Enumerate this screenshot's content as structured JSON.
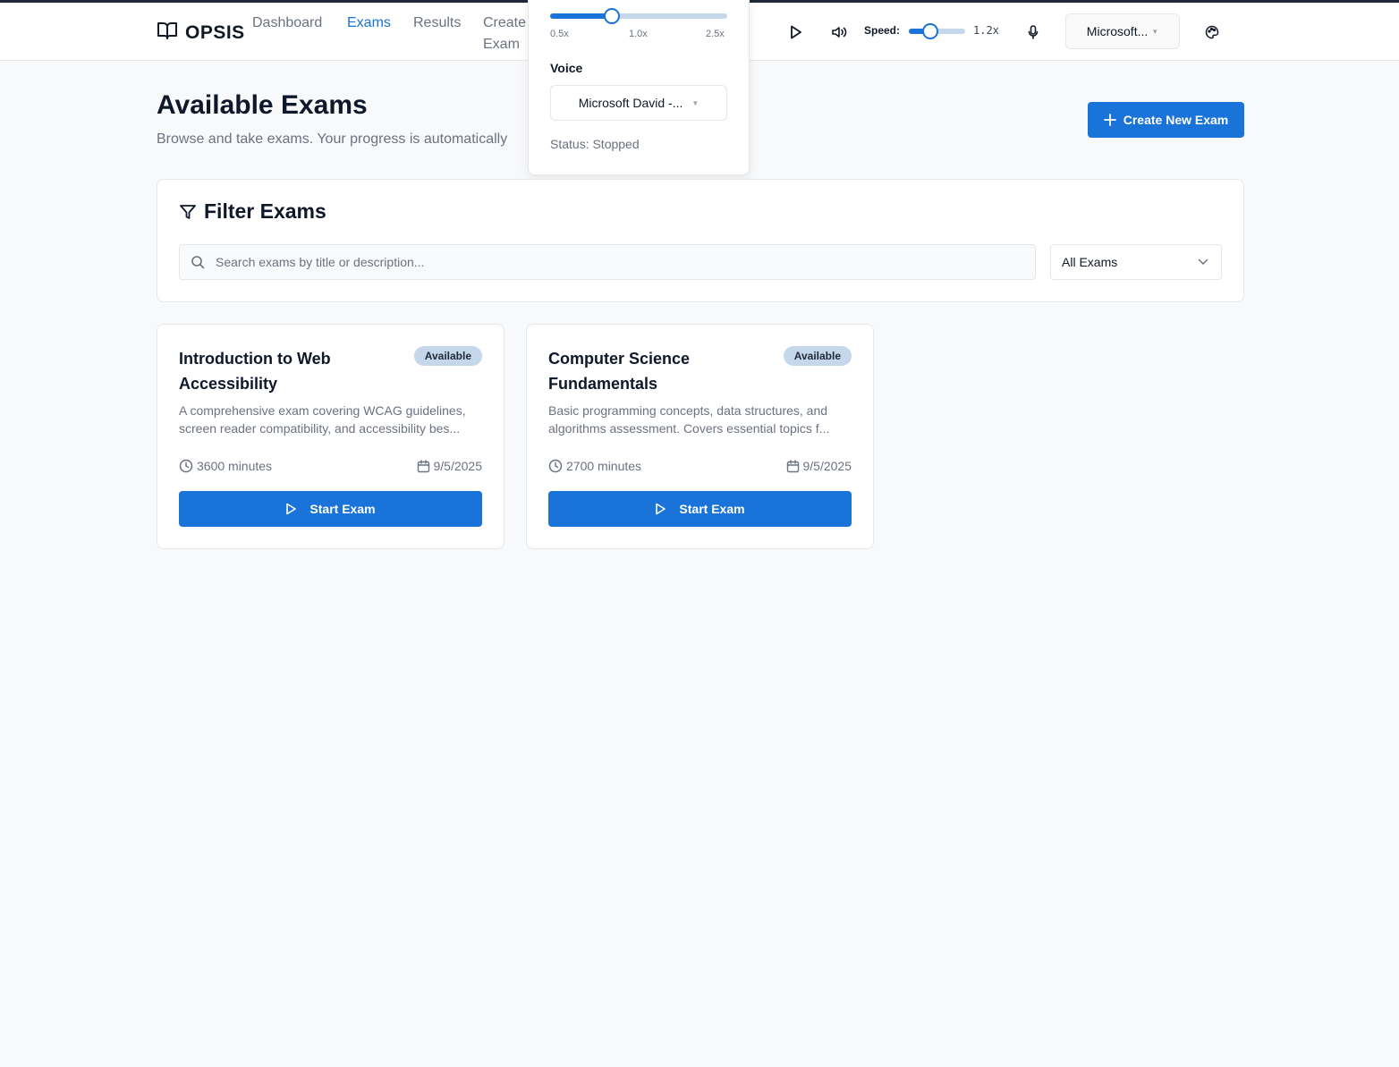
{
  "header": {
    "logo_text": "OPSIS",
    "nav": [
      {
        "label": "Dashboard",
        "active": false
      },
      {
        "label": "Exams",
        "active": true
      },
      {
        "label": "Results",
        "active": false
      },
      {
        "label": "Create",
        "label2": "Exam",
        "active": false
      }
    ],
    "speed_label": "Speed:",
    "speed_value": "1.2x",
    "voice_select": "Microsoft..."
  },
  "popover": {
    "slider_fraction": 0.35,
    "ticks": [
      "0.5x",
      "1.0x",
      "2.5x"
    ],
    "voice_label": "Voice",
    "voice_value": "Microsoft David -...",
    "status": "Status: Stopped"
  },
  "page": {
    "title": "Available Exams",
    "subtitle": "Browse and take exams. Your progress is automatically",
    "create_button": "Create New Exam"
  },
  "filter": {
    "title": "Filter Exams",
    "search_placeholder": "Search exams by title or description...",
    "select_value": "All Exams"
  },
  "exams": [
    {
      "title": "Introduction to Web Accessibility",
      "badge": "Available",
      "description": "A comprehensive exam covering WCAG guidelines, screen reader compatibility, and accessibility bes...",
      "duration": "3600 minutes",
      "date": "9/5/2025",
      "button": "Start Exam"
    },
    {
      "title": "Computer Science Fundamentals",
      "badge": "Available",
      "description": "Basic programming concepts, data structures, and algorithms assessment. Covers essential topics f...",
      "duration": "2700 minutes",
      "date": "9/5/2025",
      "button": "Start Exam"
    }
  ],
  "colors": {
    "accent": "#1a73d9",
    "badge_bg": "#c5d7ea",
    "background": "#f8f9fb"
  }
}
